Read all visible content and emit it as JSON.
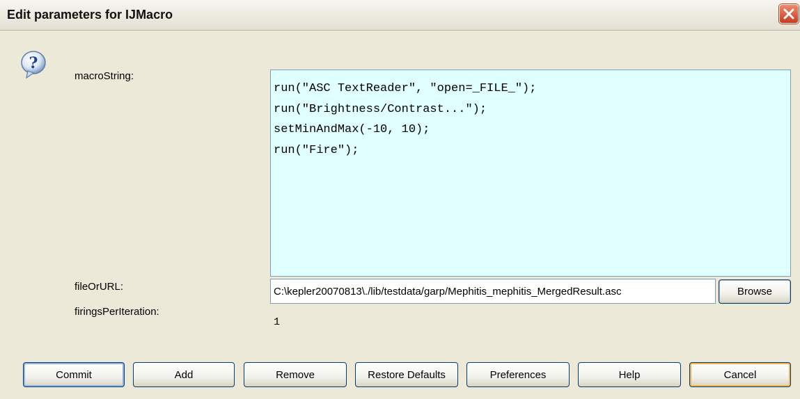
{
  "window": {
    "title": "Edit parameters for IJMacro",
    "close_icon": "close-icon"
  },
  "help_icon": "question-mark-icon",
  "params": {
    "macroString": {
      "label": "macroString:",
      "value": "run(\"ASC TextReader\", \"open=_FILE_\");\nrun(\"Brightness/Contrast...\");\nsetMinAndMax(-10, 10);\nrun(\"Fire\");",
      "background": "#e0ffff"
    },
    "fileOrURL": {
      "label": "fileOrURL:",
      "value": "C:\\kepler20070813\\./lib/testdata/garp/Mephitis_mephitis_MergedResult.asc",
      "browse_label": "Browse"
    },
    "firingsPerIteration": {
      "label": "firingsPerIteration:",
      "value": "1"
    }
  },
  "buttons": {
    "commit": "Commit",
    "add": "Add",
    "remove": "Remove",
    "restore_defaults": "Restore Defaults",
    "preferences": "Preferences",
    "help": "Help",
    "cancel": "Cancel"
  }
}
